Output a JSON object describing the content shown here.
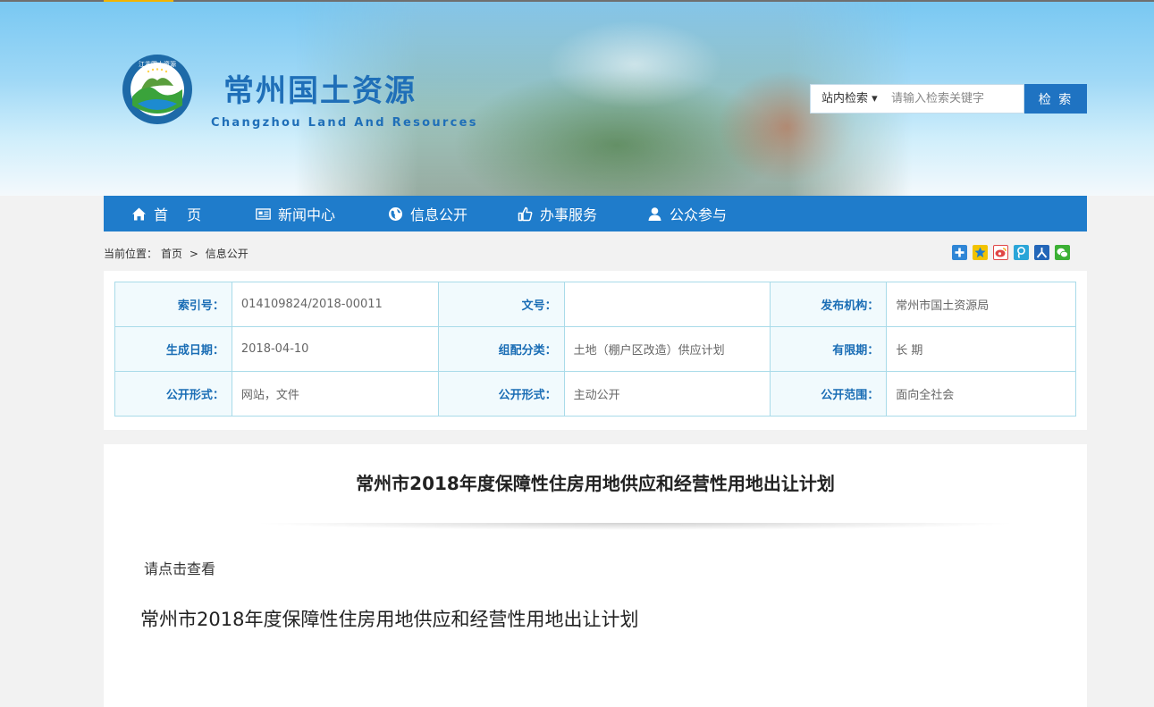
{
  "header": {
    "title": "常州国土资源",
    "subtitle": "Changzhou Land And Resources",
    "logo_text": "江苏国土资源",
    "logo_ring_text": "JIANGSU LAND & RESOURCES"
  },
  "search": {
    "scope": "站内检索 ▾",
    "placeholder": "请输入检索关键字",
    "button": "检 索"
  },
  "nav": {
    "items": [
      {
        "label": "首　 页",
        "icon": "home-icon"
      },
      {
        "label": "新闻中心",
        "icon": "newspaper-icon"
      },
      {
        "label": "信息公开",
        "icon": "globe-icon"
      },
      {
        "label": "办事服务",
        "icon": "thumbs-up-icon"
      },
      {
        "label": "公众参与",
        "icon": "user-icon"
      }
    ]
  },
  "breadcrumb": {
    "prefix": "当前位置：",
    "home": "首页",
    "sep": ">",
    "current": "信息公开"
  },
  "share": {
    "icons": [
      "add-share-icon",
      "qzone-share-icon",
      "weibo-share-icon",
      "tencent-weibo-share-icon",
      "renren-share-icon",
      "wechat-share-icon"
    ]
  },
  "meta": {
    "rows": [
      [
        {
          "key": "索引号：",
          "value": "014109824/2018-00011"
        },
        {
          "key": "文号：",
          "value": ""
        },
        {
          "key": "发布机构：",
          "value": "常州市国土资源局"
        }
      ],
      [
        {
          "key": "生成日期：",
          "value": "2018-04-10"
        },
        {
          "key": "组配分类：",
          "value": "土地（棚户区改造）供应计划"
        },
        {
          "key": "有限期：",
          "value": "长 期"
        }
      ],
      [
        {
          "key": "公开形式：",
          "value": "网站，文件"
        },
        {
          "key": "公开形式：",
          "value": "主动公开"
        },
        {
          "key": "公开范围：",
          "value": "面向全社会"
        }
      ]
    ]
  },
  "article": {
    "title": "常州市2018年度保障性住房用地供应和经营性用地出让计划",
    "hint": "请点击查看",
    "link": "常州市2018年度保障性住房用地供应和经营性用地出让计划"
  },
  "colors": {
    "nav_bg": "#1f7ccb",
    "brand_blue": "#1f6fb8",
    "table_border": "#a9dbe9",
    "accent_yellow": "#f3b400"
  }
}
